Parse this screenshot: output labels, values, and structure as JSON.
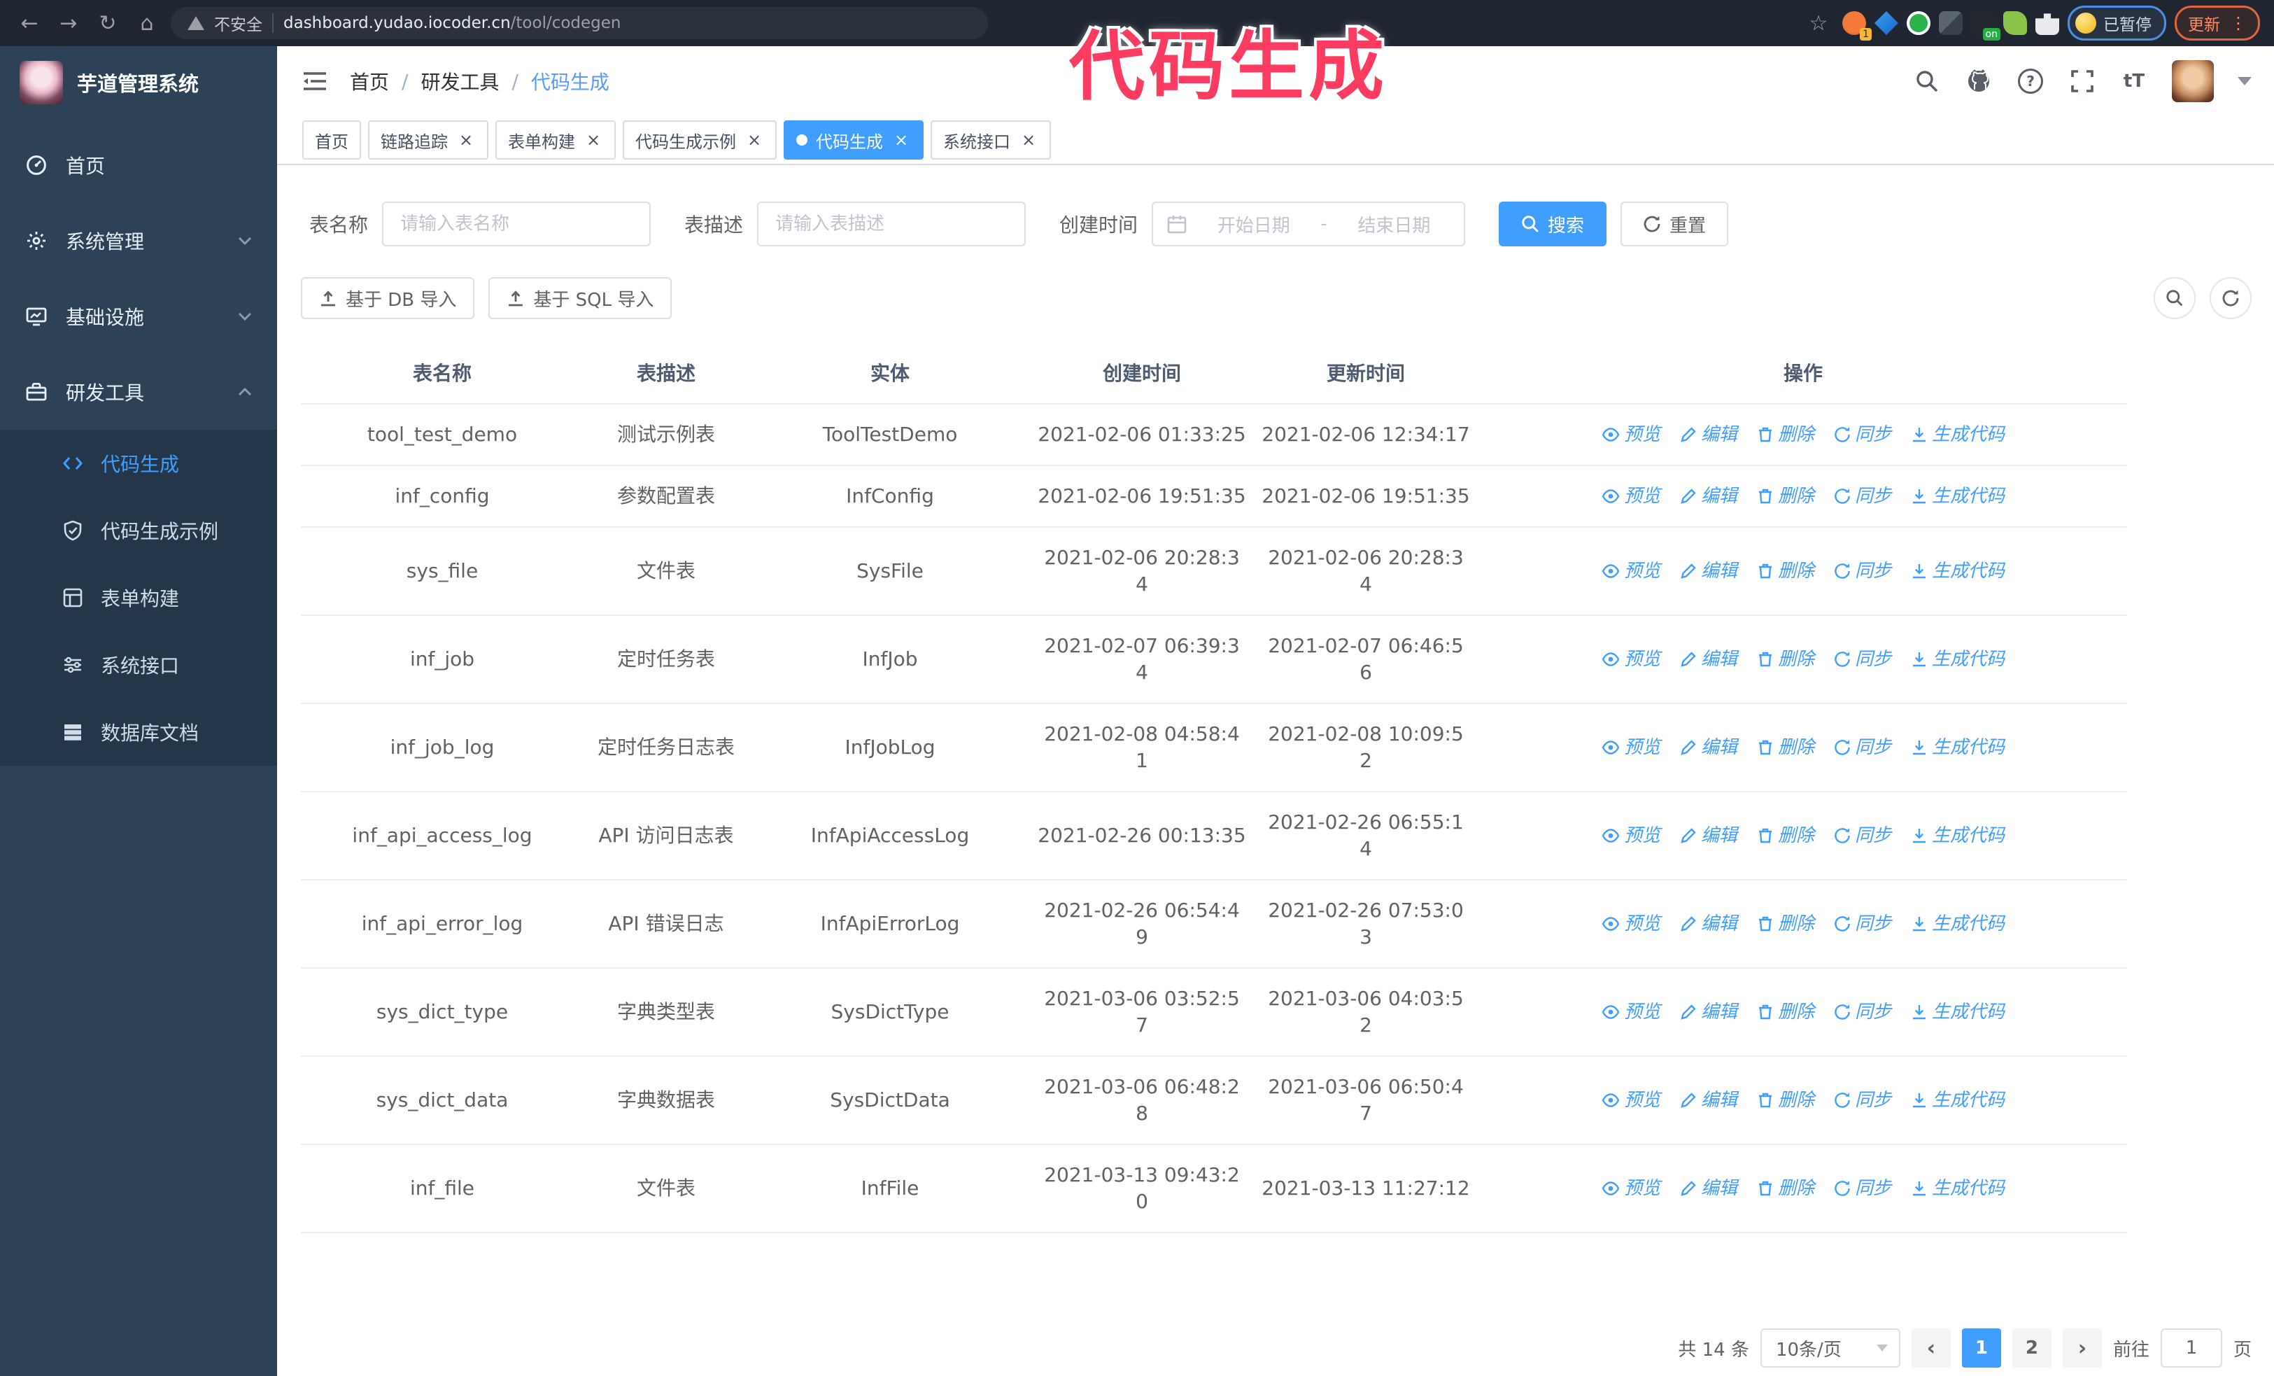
{
  "annotation": {
    "text": "代码生成",
    "color": "#fb3c60"
  },
  "browser": {
    "security_label": "不安全",
    "url_host": "dashboard.yudao.iocoder.cn",
    "url_path": "/tool/codegen",
    "extension_count_badge": "1",
    "extension_on_badge": "on",
    "paused_badge": "已暂停",
    "update_button": "更新"
  },
  "sidebar": {
    "title": "芋道管理系统",
    "items": [
      {
        "label": "首页"
      },
      {
        "label": "系统管理"
      },
      {
        "label": "基础设施"
      },
      {
        "label": "研发工具"
      }
    ],
    "sub_items": [
      {
        "label": "代码生成"
      },
      {
        "label": "代码生成示例"
      },
      {
        "label": "表单构建"
      },
      {
        "label": "系统接口"
      },
      {
        "label": "数据库文档"
      }
    ]
  },
  "breadcrumb": {
    "items": [
      "首页",
      "研发工具",
      "代码生成"
    ]
  },
  "tabs": [
    {
      "label": "首页"
    },
    {
      "label": "链路追踪"
    },
    {
      "label": "表单构建"
    },
    {
      "label": "代码生成示例"
    },
    {
      "label": "代码生成"
    },
    {
      "label": "系统接口"
    }
  ],
  "search_form": {
    "table_name_label": "表名称",
    "table_name_placeholder": "请输入表名称",
    "table_desc_label": "表描述",
    "table_desc_placeholder": "请输入表描述",
    "create_time_label": "创建时间",
    "date_start_placeholder": "开始日期",
    "date_separator": "-",
    "date_end_placeholder": "结束日期",
    "search_button": "搜索",
    "reset_button": "重置"
  },
  "toolbar": {
    "import_db_button": "基于 DB 导入",
    "import_sql_button": "基于 SQL 导入"
  },
  "table": {
    "columns": [
      "表名称",
      "表描述",
      "实体",
      "创建时间",
      "更新时间",
      "操作"
    ],
    "actions": [
      "预览",
      "编辑",
      "删除",
      "同步",
      "生成代码"
    ],
    "rows": [
      {
        "table_name": "tool_test_demo",
        "description": "测试示例表",
        "entity": "ToolTestDemo",
        "create_time": "2021-02-06 01:33:25",
        "update_time": "2021-02-06 12:34:17"
      },
      {
        "table_name": "inf_config",
        "description": "参数配置表",
        "entity": "InfConfig",
        "create_time": "2021-02-06 19:51:35",
        "update_time": "2021-02-06 19:51:35"
      },
      {
        "table_name": "sys_file",
        "description": "文件表",
        "entity": "SysFile",
        "create_time": "2021-02-06 20:28:3\n4",
        "update_time": "2021-02-06 20:28:3\n4"
      },
      {
        "table_name": "inf_job",
        "description": "定时任务表",
        "entity": "InfJob",
        "create_time": "2021-02-07 06:39:3\n4",
        "update_time": "2021-02-07 06:46:5\n6"
      },
      {
        "table_name": "inf_job_log",
        "description": "定时任务日志表",
        "entity": "InfJobLog",
        "create_time": "2021-02-08 04:58:4\n1",
        "update_time": "2021-02-08 10:09:5\n2"
      },
      {
        "table_name": "inf_api_access_log",
        "description": "API 访问日志表",
        "entity": "InfApiAccessLog",
        "create_time": "2021-02-26 00:13:35",
        "update_time": "2021-02-26 06:55:1\n4"
      },
      {
        "table_name": "inf_api_error_log",
        "description": "API 错误日志",
        "entity": "InfApiErrorLog",
        "create_time": "2021-02-26 06:54:4\n9",
        "update_time": "2021-02-26 07:53:0\n3"
      },
      {
        "table_name": "sys_dict_type",
        "description": "字典类型表",
        "entity": "SysDictType",
        "create_time": "2021-03-06 03:52:5\n7",
        "update_time": "2021-03-06 04:03:5\n2"
      },
      {
        "table_name": "sys_dict_data",
        "description": "字典数据表",
        "entity": "SysDictData",
        "create_time": "2021-03-06 06:48:2\n8",
        "update_time": "2021-03-06 06:50:4\n7"
      },
      {
        "table_name": "inf_file",
        "description": "文件表",
        "entity": "InfFile",
        "create_time": "2021-03-13 09:43:2\n0",
        "update_time": "2021-03-13 11:27:12"
      }
    ]
  },
  "pagination": {
    "total_text": "共 14 条",
    "page_size": "10条/页",
    "pages": [
      "1",
      "2"
    ],
    "goto_label": "前往",
    "goto_value": "1",
    "goto_suffix": "页"
  }
}
